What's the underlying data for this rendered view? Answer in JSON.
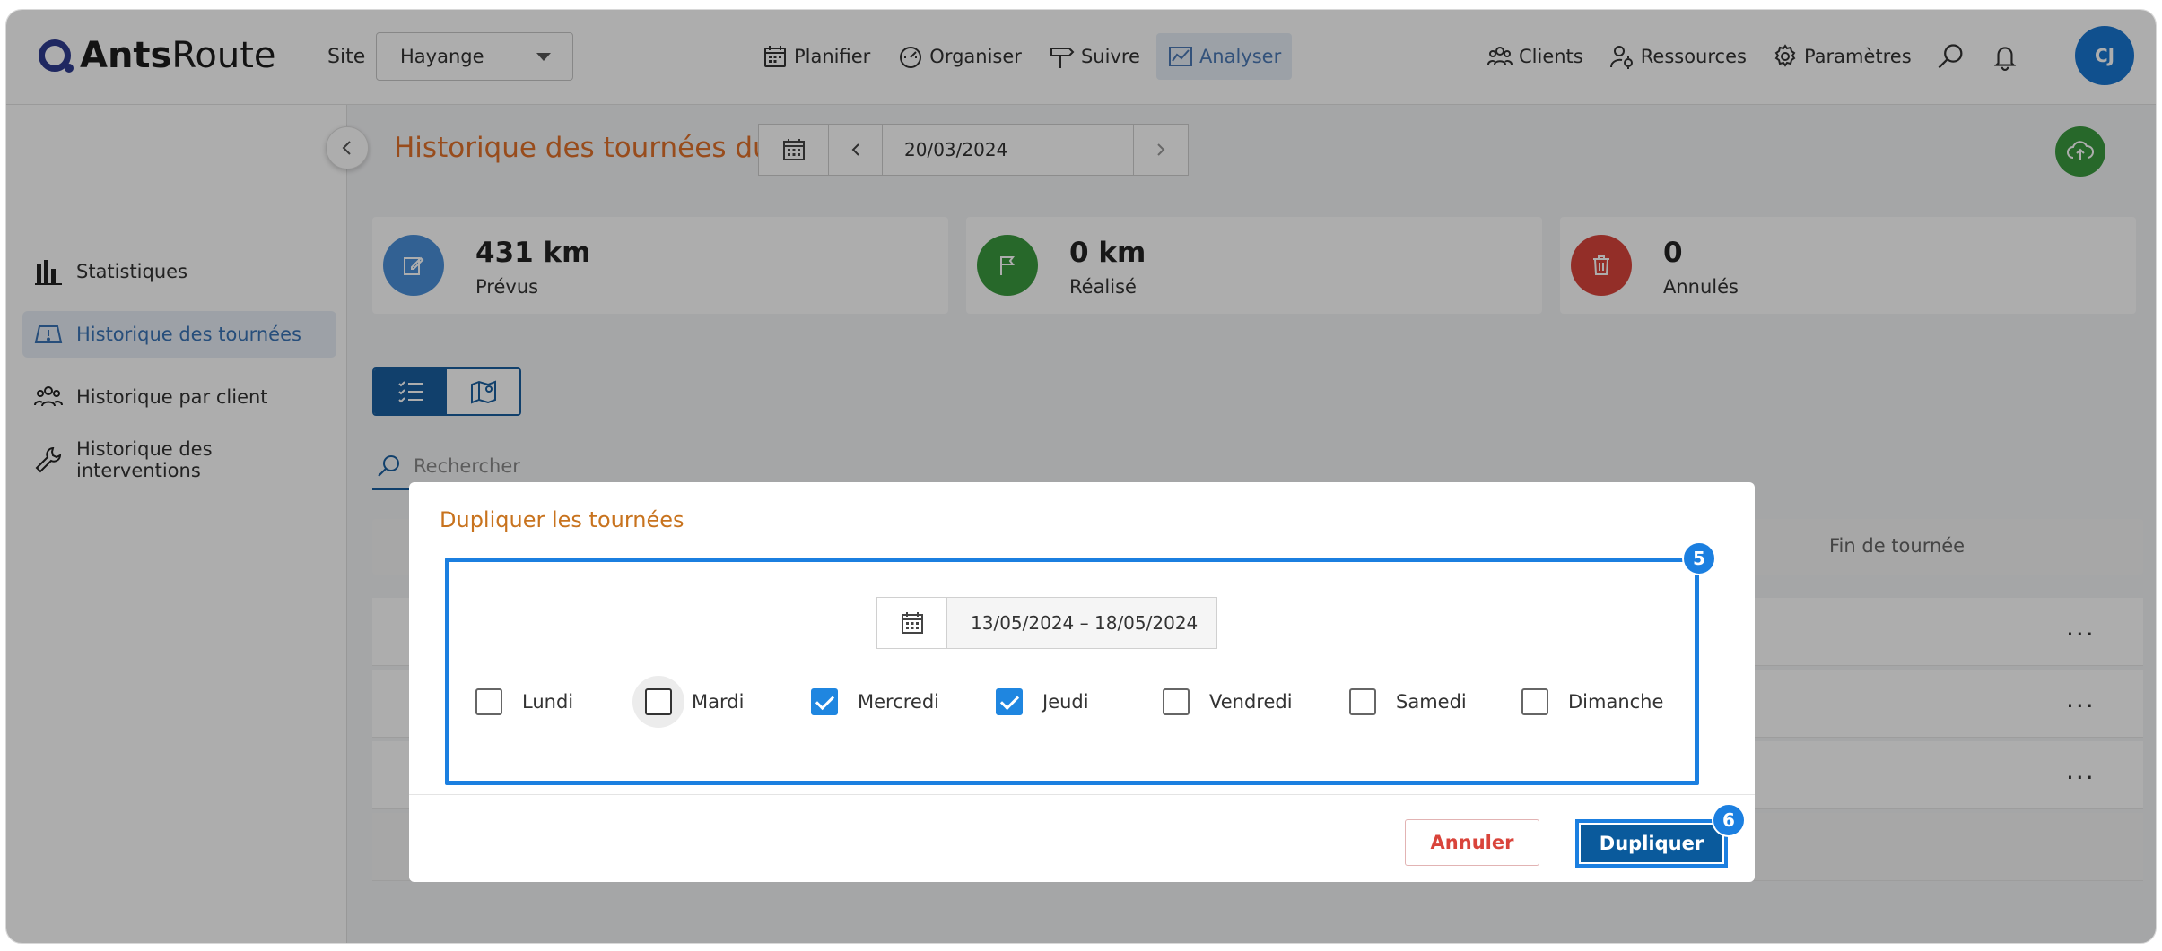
{
  "app": {
    "logo_bold": "Ants",
    "logo_light": "Route"
  },
  "header": {
    "site_label": "Site",
    "site_value": "Hayange",
    "nav": [
      {
        "label": "Planifier",
        "icon": "calendar-icon"
      },
      {
        "label": "Organiser",
        "icon": "dashboard-icon"
      },
      {
        "label": "Suivre",
        "icon": "signpost-icon"
      },
      {
        "label": "Analyser",
        "icon": "chart-icon",
        "active": true
      }
    ],
    "right_nav": [
      {
        "label": "Clients",
        "icon": "clients-icon"
      },
      {
        "label": "Ressources",
        "icon": "resources-icon"
      },
      {
        "label": "Paramètres",
        "icon": "gear-icon"
      }
    ],
    "avatar_initials": "CJ"
  },
  "sidebar": {
    "items": [
      {
        "label": "Statistiques",
        "icon": "bar-chart-icon"
      },
      {
        "label": "Historique des tournées",
        "icon": "map-alert-icon",
        "active": true
      },
      {
        "label": "Historique par client",
        "icon": "group-icon"
      },
      {
        "label": "Historique des interventions",
        "icon": "wrench-icon"
      }
    ]
  },
  "page": {
    "title": "Historique des tournées du",
    "date": "20/03/2024"
  },
  "stats": [
    {
      "value": "431 km",
      "label": "Prévus",
      "color": "#4a90d9",
      "icon": "edit-icon"
    },
    {
      "value": "0 km",
      "label": "Réalisé",
      "color": "#3a9a3e",
      "icon": "flag-icon"
    },
    {
      "value": "0",
      "label": "Annulés",
      "color": "#d9443b",
      "icon": "trash-icon"
    }
  ],
  "search": {
    "placeholder": "Rechercher"
  },
  "table": {
    "last_column": "Fin de tournée",
    "row_menu": "..."
  },
  "modal": {
    "title": "Dupliquer les tournées",
    "date_range": "13/05/2024 – 18/05/2024",
    "days": [
      {
        "label": "Lundi",
        "checked": false
      },
      {
        "label": "Mardi",
        "checked": false
      },
      {
        "label": "Mercredi",
        "checked": true
      },
      {
        "label": "Jeudi",
        "checked": true
      },
      {
        "label": "Vendredi",
        "checked": false
      },
      {
        "label": "Samedi",
        "checked": false
      },
      {
        "label": "Dimanche",
        "checked": false
      }
    ],
    "cancel_label": "Annuler",
    "duplicate_label": "Dupliquer",
    "step_badges": [
      "5",
      "6"
    ]
  },
  "colors": {
    "accent": "#1b7fe0",
    "title_orange": "#e0702a",
    "primary_dark": "#0a5a9c"
  }
}
